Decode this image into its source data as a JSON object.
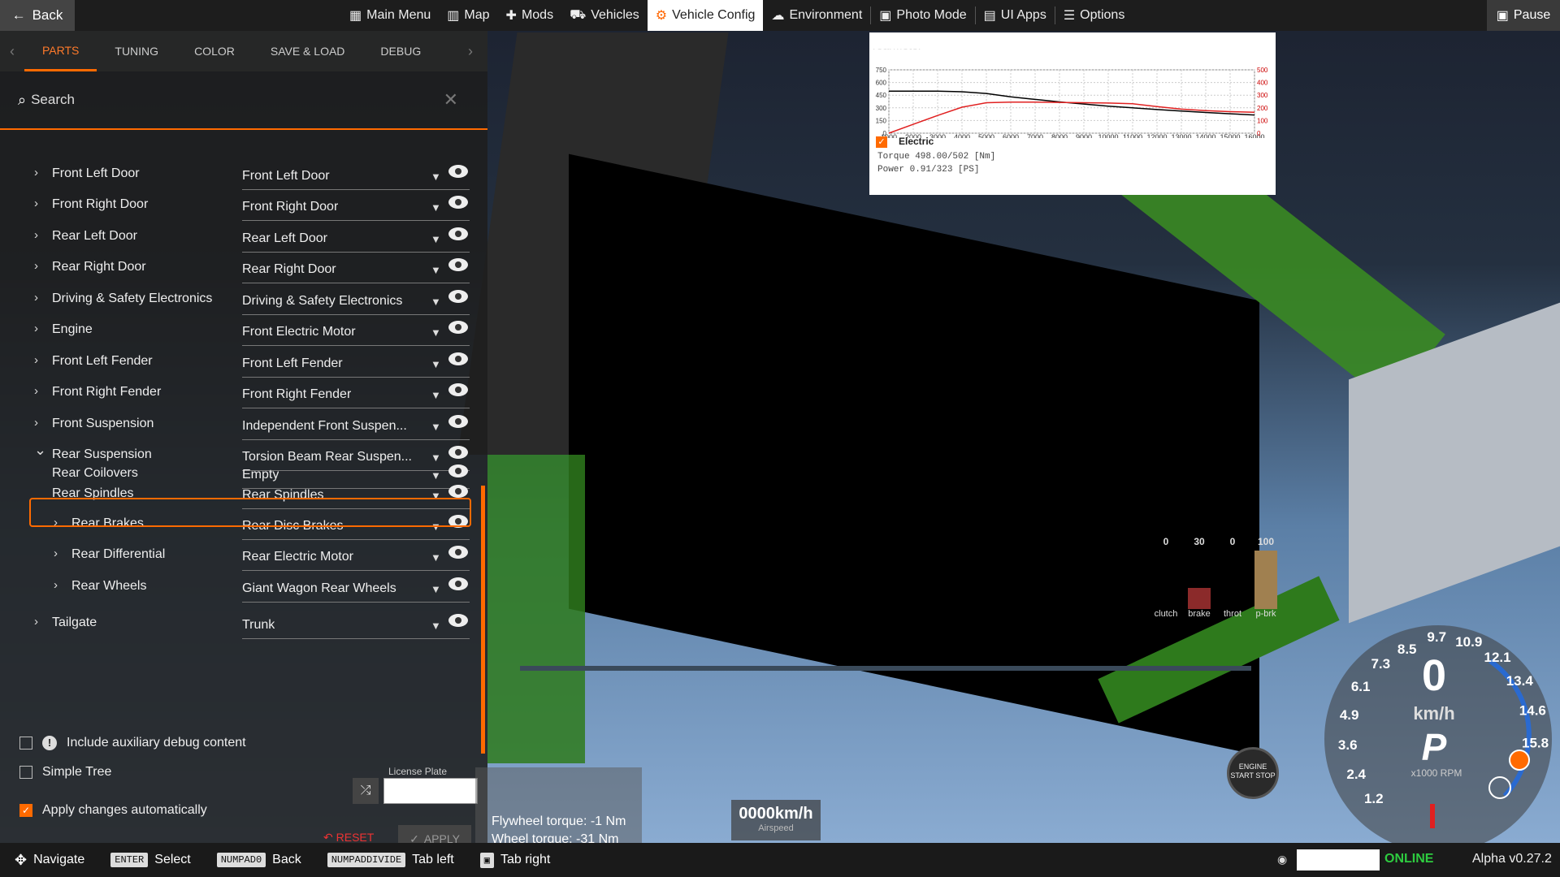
{
  "topbar": {
    "back": "Back",
    "nav": [
      {
        "label": "Main Menu",
        "icon": "main-menu-icon",
        "glyph": "▦",
        "active": false
      },
      {
        "label": "Map",
        "icon": "map-icon",
        "glyph": "▥",
        "active": false
      },
      {
        "label": "Mods",
        "icon": "mods-icon",
        "glyph": "✚",
        "active": false
      },
      {
        "label": "Vehicles",
        "icon": "vehicles-icon",
        "glyph": "⛟",
        "active": false
      },
      {
        "label": "Vehicle Config",
        "icon": "vehicle-config-icon",
        "glyph": "⚙",
        "active": true
      },
      {
        "label": "Environment",
        "icon": "environment-icon",
        "glyph": "☁",
        "active": false
      },
      {
        "label": "Photo Mode",
        "icon": "camera-icon",
        "glyph": "▣",
        "active": false
      },
      {
        "label": "UI Apps",
        "icon": "ui-apps-icon",
        "glyph": "▤",
        "active": false
      },
      {
        "label": "Options",
        "icon": "options-icon",
        "glyph": "☰",
        "active": false
      }
    ],
    "pause": "Pause"
  },
  "tabs": [
    "PARTS",
    "TUNING",
    "COLOR",
    "SAVE & LOAD",
    "DEBUG"
  ],
  "search": {
    "label": "Search"
  },
  "parts": [
    {
      "name": "Front Left Door",
      "value": "Front Left Door",
      "level": 0,
      "expanded": false
    },
    {
      "name": "Front Right Door",
      "value": "Front Right Door",
      "level": 0,
      "expanded": false
    },
    {
      "name": "Rear Left Door",
      "value": "Rear Left Door",
      "level": 0,
      "expanded": false
    },
    {
      "name": "Rear Right Door",
      "value": "Rear Right Door",
      "level": 0,
      "expanded": false
    },
    {
      "name": "Driving & Safety Electronics",
      "value": "Driving & Safety Electronics",
      "level": 0,
      "expanded": false
    },
    {
      "name": "Engine",
      "value": "Front Electric Motor",
      "level": 0,
      "expanded": false
    },
    {
      "name": "Front Left Fender",
      "value": "Front Left Fender",
      "level": 0,
      "expanded": false
    },
    {
      "name": "Front Right Fender",
      "value": "Front Right Fender",
      "level": 0,
      "expanded": false
    },
    {
      "name": "Front Suspension",
      "value": "Independent Front Suspen...",
      "level": 0,
      "expanded": false
    },
    {
      "name": "Rear Suspension",
      "value": "Torsion Beam Rear Suspen...",
      "level": 0,
      "expanded": true
    },
    {
      "name": "Rear Coilovers",
      "value": "Empty",
      "level": 1,
      "leaf": true
    },
    {
      "name": "Rear Spindles",
      "value": "Rear Spindles",
      "level": 1,
      "leaf": true
    },
    {
      "name": "Rear Brakes",
      "value": "Rear Disc Brakes",
      "level": 1,
      "expanded": false
    },
    {
      "name": "Rear Differential",
      "value": "Rear Electric Motor",
      "level": 1,
      "expanded": false
    },
    {
      "name": "Rear Wheels",
      "value": "Giant Wagon Rear Wheels",
      "level": 1,
      "expanded": false
    },
    {
      "name": "Tailgate",
      "value": "Trunk",
      "level": 0,
      "expanded": false
    }
  ],
  "options": {
    "debug": "Include auxiliary debug content",
    "simple_tree": "Simple Tree",
    "apply_auto": "Apply changes automatically",
    "license_label": "License Plate",
    "reset": "RESET",
    "apply": "APPLY"
  },
  "graph": {
    "title": "rearMotor",
    "series_label": "Electric",
    "torque": "Torque 498.00/502 [Nm]",
    "power": "Power  0.91/323   [PS]",
    "left_ticks": [
      "750",
      "600",
      "450",
      "300",
      "150",
      "0"
    ],
    "right_ticks": [
      "500",
      "400",
      "300",
      "200",
      "100",
      "0"
    ],
    "x_ticks": [
      "1000",
      "2000",
      "3000",
      "4000",
      "5000",
      "6000",
      "7000",
      "8000",
      "9000",
      "10000",
      "11000",
      "12000",
      "13000",
      "14000",
      "15000",
      "16000"
    ],
    "torque_color": "#000000",
    "power_color": "#e02020"
  },
  "pedals": [
    {
      "value": "0",
      "label": "clutch",
      "color": "#555555",
      "fill": 0
    },
    {
      "value": "30",
      "label": "brake",
      "color": "#8b2a2a",
      "fill": 0.3
    },
    {
      "value": "0",
      "label": "throt",
      "color": "#555555",
      "fill": 0
    },
    {
      "value": "100",
      "label": "p-brk",
      "color": "#a08050",
      "fill": 1
    }
  ],
  "gauge": {
    "speed": "0",
    "unit": "km/h",
    "gear": "P",
    "rpm_label": "x1000 RPM",
    "ticks": [
      "1.2",
      "2.4",
      "3.6",
      "4.9",
      "6.1",
      "7.3",
      "8.5",
      "9.7",
      "10.9",
      "12.1",
      "13.4",
      "14.6",
      "15.8"
    ]
  },
  "telemetry": {
    "line1": "Flywheel torque: -1 Nm",
    "line2": "Wheel torque: -31 Nm"
  },
  "airspeed": {
    "value": "0000km/h",
    "label": "Airspeed"
  },
  "engine_button": "ENGINE START STOP",
  "bottombar": {
    "hints": [
      {
        "key": "✥",
        "label": "Navigate"
      },
      {
        "key": "ENTER",
        "label": "Select"
      },
      {
        "key": "NUMPAD0",
        "label": "Back"
      },
      {
        "key": "NUMPADDIVIDE",
        "label": "Tab left"
      },
      {
        "key": "▣",
        "label": "Tab right"
      }
    ],
    "status": "ONLINE",
    "version": "Alpha v0.27.2"
  }
}
